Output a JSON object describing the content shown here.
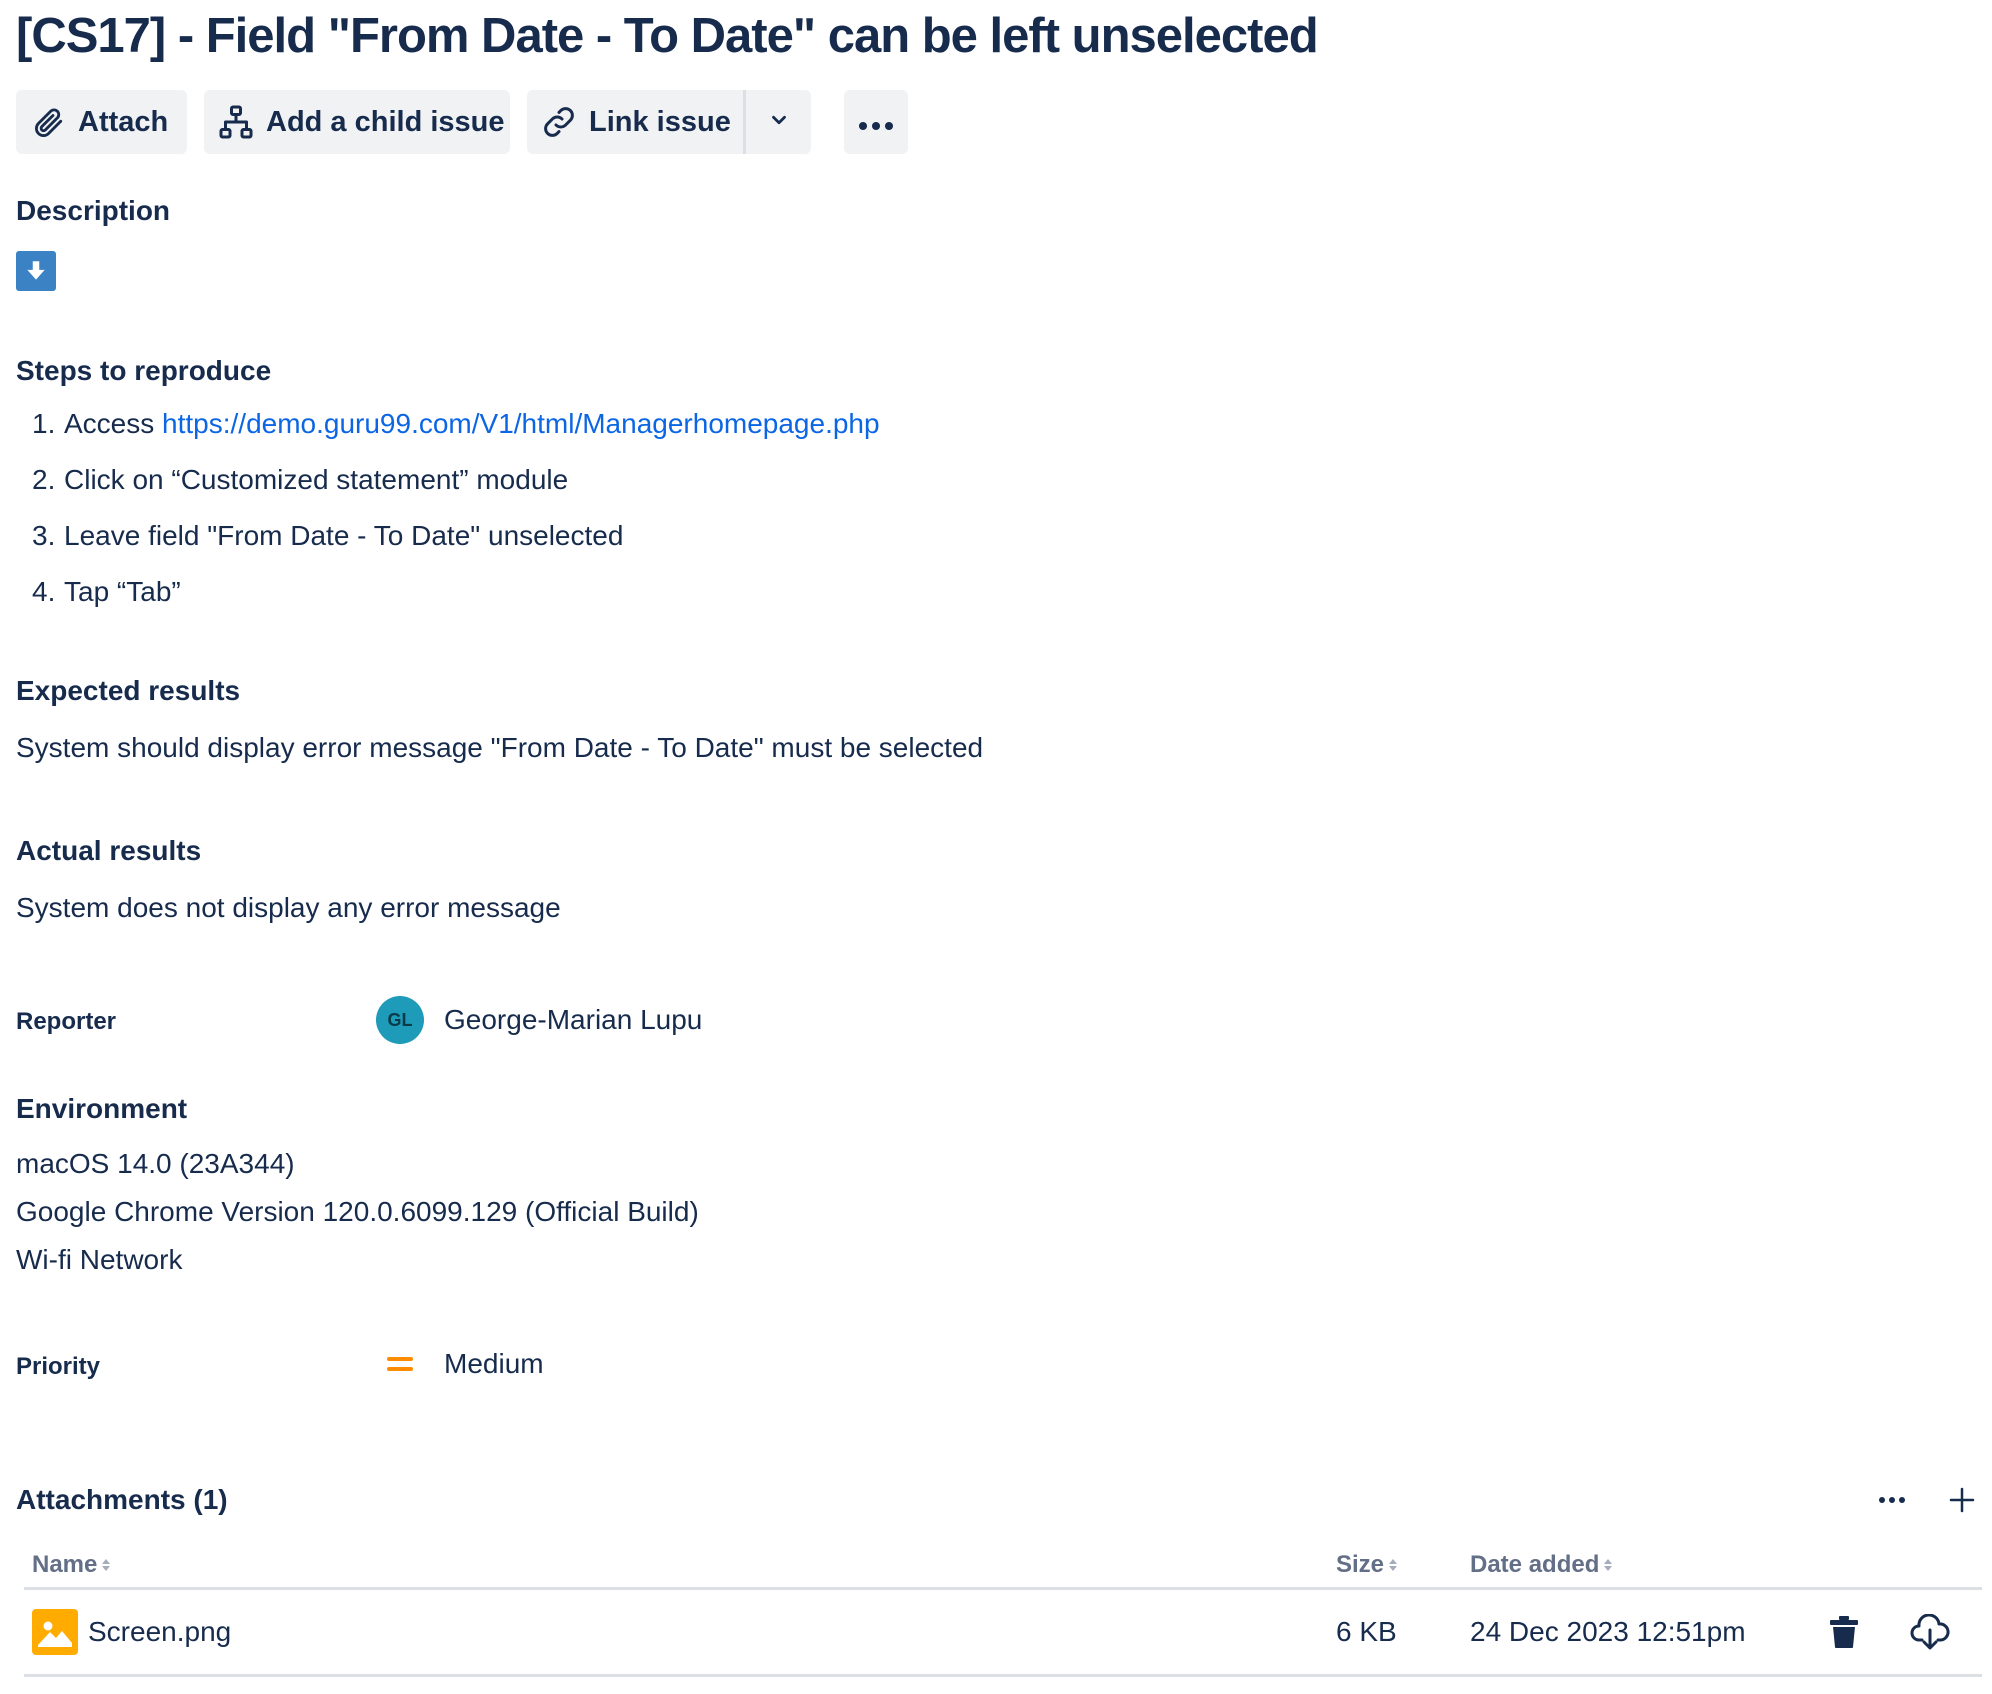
{
  "issue": {
    "title": "[CS17] - Field \"From Date - To Date\" can be left unselected"
  },
  "toolbar": {
    "attach_label": "Attach",
    "add_child_label": "Add a child issue",
    "link_issue_label": "Link issue"
  },
  "description": {
    "heading": "Description"
  },
  "steps": {
    "heading": "Steps to reproduce",
    "items": [
      {
        "num": "1.",
        "text": "Access ",
        "link": "https://demo.guru99.com/V1/html/Managerhomepage.php"
      },
      {
        "num": "2.",
        "text": "Click on “Customized statement” module"
      },
      {
        "num": "3.",
        "text": "Leave field \"From Date - To Date\" unselected"
      },
      {
        "num": "4.",
        "text": "Tap “Tab”"
      }
    ]
  },
  "expected": {
    "heading": "Expected results",
    "text": "System should display error message \"From Date - To Date\" must be selected"
  },
  "actual": {
    "heading": "Actual results",
    "text": "System does not display any error message"
  },
  "reporter": {
    "label": "Reporter",
    "initials": "GL",
    "name": "George-Marian Lupu",
    "avatar_color": "#1d9bb8"
  },
  "environment": {
    "heading": "Environment",
    "lines": [
      "macOS 14.0 (23A344)",
      "Google Chrome Version 120.0.6099.129 (Official Build)",
      "Wi-fi Network"
    ]
  },
  "priority": {
    "label": "Priority",
    "value": "Medium",
    "icon": "priority-medium-icon",
    "color": "#ff8b00"
  },
  "attachments": {
    "heading": "Attachments (1)",
    "columns": {
      "name": "Name",
      "size": "Size",
      "date": "Date added"
    },
    "files": [
      {
        "name": "Screen.png",
        "size": "6 KB",
        "date": "24 Dec 2023 12:51pm",
        "icon": "image-file-icon"
      }
    ]
  },
  "colors": {
    "text": "#172b4d",
    "link": "#0c66e4",
    "button_bg": "#f1f2f4",
    "muted": "#626f86"
  }
}
